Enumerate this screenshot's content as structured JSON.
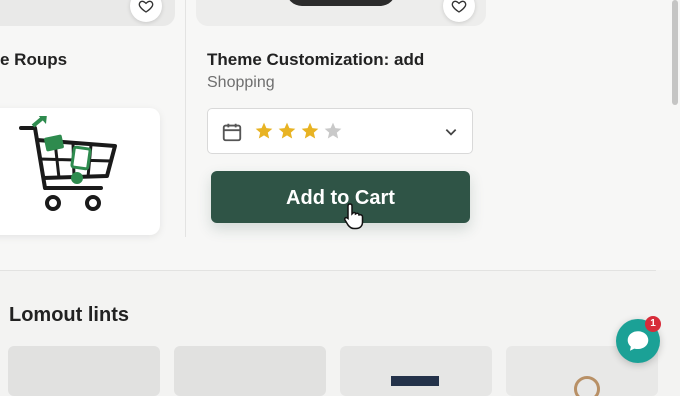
{
  "left_product": {
    "title": "e Roups",
    "favorite_icon": "heart-outline-icon",
    "image_icon": "shopping-cart-icon"
  },
  "product": {
    "title": "Theme Customization: add",
    "category": "Shopping",
    "favorite_icon": "heart-outline-icon",
    "rating": {
      "value": 3,
      "max": 4,
      "filled_color": "#e8b323",
      "empty_color": "#c9c9c9"
    },
    "add_to_cart_label": "Add to Cart",
    "button_color": "#2f5446"
  },
  "section": {
    "title": "Lomout lints"
  },
  "chat": {
    "badge_count": "1",
    "color": "#1ba196",
    "badge_color": "#d72c3a"
  }
}
